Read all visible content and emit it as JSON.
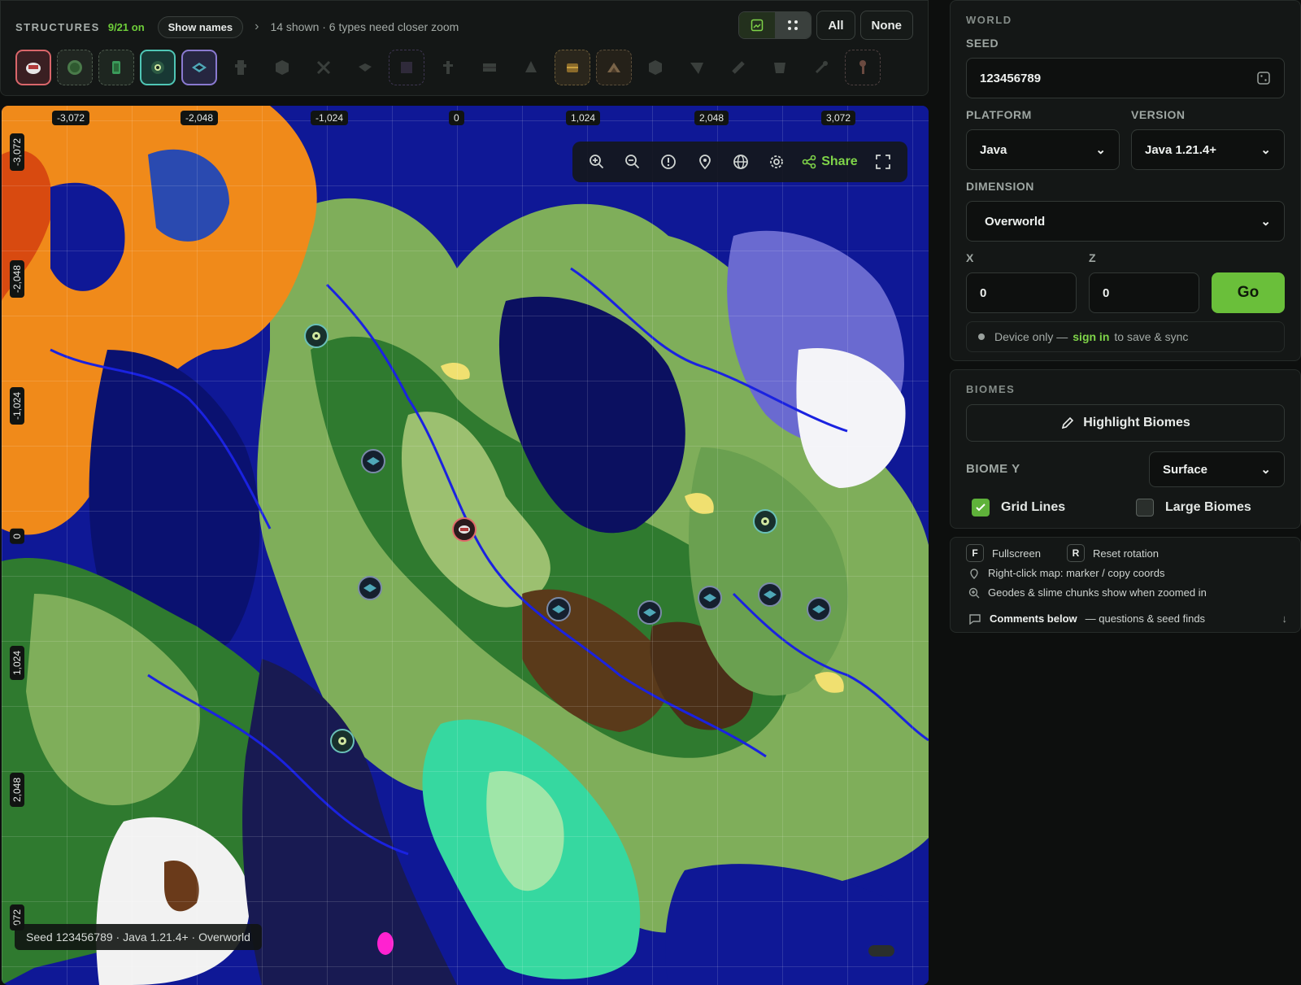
{
  "structures": {
    "title": "STRUCTURES",
    "count": "9/21 on",
    "show_names_label": "Show names",
    "status": "14 shown · 6 types need closer zoom",
    "all_label": "All",
    "none_label": "None",
    "icons": [
      "ruined-portal-icon",
      "slime-icon",
      "emerald-ore-icon",
      "stronghold-eye-icon",
      "ancient-city-icon",
      "pillager-outpost-icon",
      "mineshaft-icon",
      "sword-icon",
      "boat-icon",
      "end-city-icon",
      "tree-icon",
      "monument-icon",
      "tent-icon",
      "buried-treasure-icon",
      "swamp-hut-icon",
      "mansion-icon",
      "trail-ruins-icon",
      "fossil-icon",
      "cauldron-icon",
      "spawner-icon",
      "key-icon"
    ]
  },
  "map": {
    "x_ticks": [
      "-3,072",
      "-2,048",
      "-1,024",
      "0",
      "1,024",
      "2,048",
      "3,072"
    ],
    "y_ticks": [
      "-3,072",
      "-2,048",
      "-1,024",
      "0",
      "1,024",
      "2,048",
      "072"
    ],
    "share_label": "Share",
    "status": "Seed 123456789 · Java 1.21.4+ · Overworld"
  },
  "world": {
    "section": "WORLD",
    "seed_label": "SEED",
    "seed_value": "123456789",
    "platform_label": "PLATFORM",
    "platform_value": "Java",
    "version_label": "VERSION",
    "version_value": "Java 1.21.4+",
    "dimension_label": "DIMENSION",
    "dimension_value": "Overworld",
    "x_label": "X",
    "x_value": "0",
    "z_label": "Z",
    "z_value": "0",
    "go_label": "Go",
    "device_text": "Device only —",
    "sign_in": "sign in",
    "device_text2": "to save & sync"
  },
  "biomes": {
    "section": "BIOMES",
    "highlight_label": "Highlight Biomes",
    "biome_y_label": "BIOME Y",
    "biome_y_value": "Surface",
    "grid_lines_label": "Grid Lines",
    "grid_lines_on": true,
    "large_biomes_label": "Large Biomes",
    "large_biomes_on": false
  },
  "help": {
    "f_key": "F",
    "fullscreen": "Fullscreen",
    "r_key": "R",
    "reset_rotation": "Reset rotation",
    "right_click": "Right-click map: marker / copy coords",
    "geodes": "Geodes & slime chunks show when zoomed in",
    "comments_bold": "Comments below",
    "comments_rest": "— questions & seed finds"
  },
  "colors": {
    "accent": "#6abf3a",
    "ocean": "#0f1896",
    "panel": "#141716"
  }
}
